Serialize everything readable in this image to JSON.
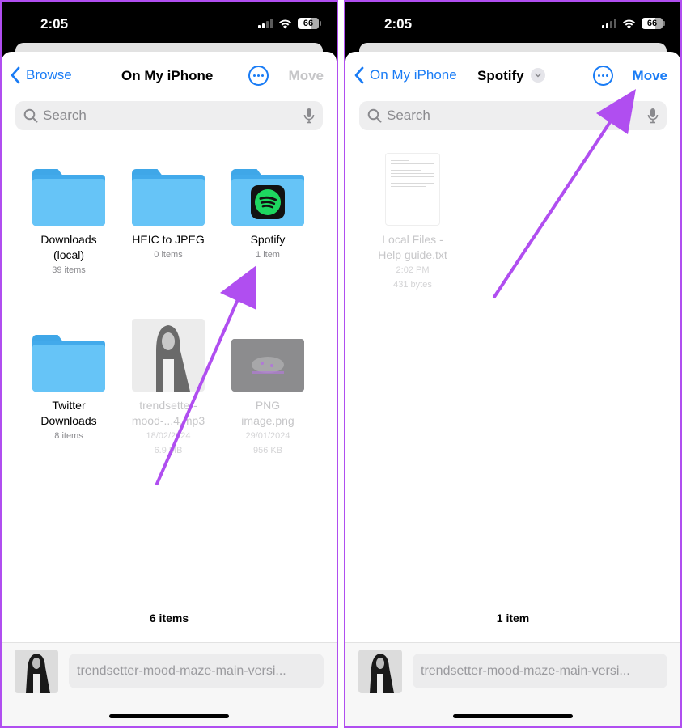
{
  "colors": {
    "accent": "#1a7cf5",
    "annotation": "#b04ef0",
    "folder": "#66c4f7",
    "spotify_green": "#1ed760"
  },
  "left": {
    "status": {
      "time": "2:05",
      "battery": "66"
    },
    "nav": {
      "back_label": "Browse",
      "title": "On My iPhone",
      "more_icon": "ellipsis-circle-icon",
      "move_label": "Move",
      "move_enabled": false
    },
    "search": {
      "placeholder": "Search"
    },
    "items": [
      {
        "type": "folder",
        "name_line1": "Downloads",
        "name_line2": "(local)",
        "meta1": "39 items"
      },
      {
        "type": "folder",
        "name_line1": "HEIC to JPEG",
        "name_line2": "",
        "meta1": "0 items"
      },
      {
        "type": "folder",
        "name_line1": "Spotify",
        "name_line2": "",
        "meta1": "1 item",
        "badge": "spotify-icon"
      },
      {
        "type": "folder",
        "name_line1": "Twitter",
        "name_line2": "Downloads",
        "meta1": "8 items"
      },
      {
        "type": "file",
        "name_line1": "trendsetter-",
        "name_line2": "mood-...4.mp3",
        "meta1": "18/02/2024",
        "meta2": "6.9 MB"
      },
      {
        "type": "file",
        "name_line1": "PNG",
        "name_line2": "image.png",
        "meta1": "29/01/2024",
        "meta2": "956 KB"
      }
    ],
    "footer_count": "6 items",
    "bottom_file_name": "trendsetter-mood-maze-main-versi..."
  },
  "right": {
    "status": {
      "time": "2:05",
      "battery": "66"
    },
    "nav": {
      "back_label": "On My iPhone",
      "title": "Spotify",
      "more_icon": "ellipsis-circle-icon",
      "move_label": "Move",
      "move_enabled": true
    },
    "search": {
      "placeholder": "Search"
    },
    "items": [
      {
        "type": "file",
        "name_line1": "Local Files -",
        "name_line2": "Help guide.txt",
        "meta1": "2:02 PM",
        "meta2": "431 bytes"
      }
    ],
    "footer_count": "1 item",
    "bottom_file_name": "trendsetter-mood-maze-main-versi..."
  }
}
